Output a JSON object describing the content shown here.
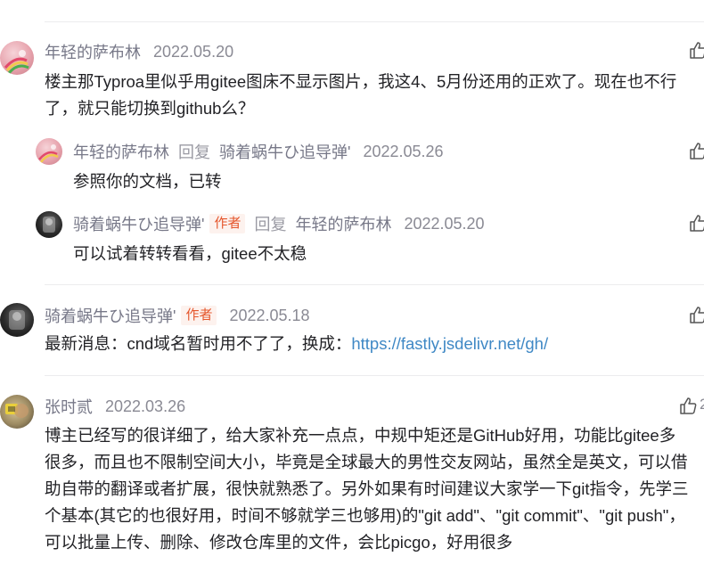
{
  "comments": [
    {
      "user": "年轻的萨布林",
      "date": "2022.05.20",
      "lines": [
        "楼主那Typroa里似乎用gitee图床不显示图片，我这4、5月份还用的正欢了。现在也不行",
        "了，就只能切换到github么？"
      ],
      "replies": [
        {
          "user": "年轻的萨布林",
          "reply_word": "回复",
          "reply_to": "骑着蜗牛ひ追导弹'",
          "date": "2022.05.26",
          "text": "参照你的文档，已转"
        },
        {
          "user": "骑着蜗牛ひ追导弹'",
          "badge": "作者",
          "reply_word": "回复",
          "reply_to": "年轻的萨布林",
          "date": "2022.05.20",
          "text": "可以试着转转看看，gitee不太稳"
        }
      ]
    },
    {
      "user": "骑着蜗牛ひ追导弹'",
      "badge": "作者",
      "date": "2022.05.18",
      "text": "最新消息：cnd域名暂时用不了了，换成：",
      "link": "https://fastly.jsdelivr.net/gh/"
    },
    {
      "user": "张时贰",
      "date": "2022.03.26",
      "like_count": "2",
      "lines": [
        "博主已经写的很详细了，给大家补充一点点，中规中矩还是GitHub好用，功能比gitee多",
        "很多，而且也不限制空间大小，毕竟是全球最大的男性交友网站，虽然全是英文，可以借",
        "助自带的翻译或者扩展，很快就熟悉了。另外如果有时间建议大家学一下git指令，先学三",
        "个基本(其它的也很好用，时间不够就学三也够用)的\"git add\"、\"git commit\"、\"git push\"，",
        "可以批量上传、删除、修改仓库里的文件，会比picgo，好用很多"
      ]
    }
  ],
  "icons": {
    "like": "thumbs-up-icon"
  }
}
